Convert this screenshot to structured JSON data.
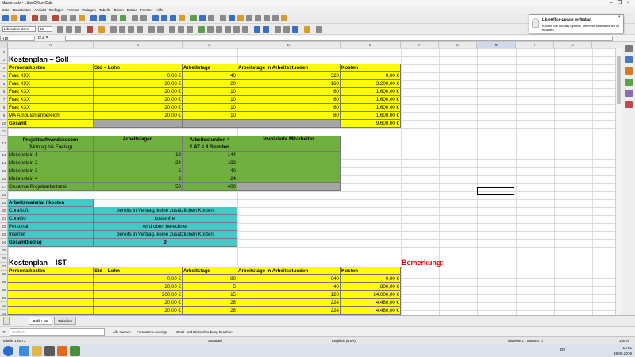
{
  "window": {
    "title": "Master.ods - LibreOffice Calc",
    "close_glyph": "×",
    "min_glyph": "–",
    "max_glyph": "❐"
  },
  "menu": [
    "Datei",
    "Bearbeiten",
    "Ansicht",
    "Einfügen",
    "Format",
    "Vorlagen",
    "Tabelle",
    "Daten",
    "Extras",
    "Fenster",
    "Hilfe"
  ],
  "formatting": {
    "font": "Liberation Sans",
    "size": "10"
  },
  "formula_bar": {
    "cell_ref": "H19",
    "fx": "fx Σ =",
    "value": ""
  },
  "notification": {
    "title": "LibreOffice-Update verfügbar",
    "body": "Klicken Sie auf das Symbol, um mehr Informationen zu erhalten.",
    "close": "×"
  },
  "columns": [
    "A",
    "B",
    "C",
    "D",
    "E",
    "F",
    "G",
    "H",
    "I",
    "J"
  ],
  "rows": [
    "1",
    "2",
    "3",
    "4",
    "5",
    "6",
    "7",
    "8",
    "9",
    "10",
    "11",
    "12",
    "13",
    "14",
    "15",
    "16",
    "17",
    "18",
    "19",
    "20",
    "21",
    "22",
    "23",
    "24",
    "25",
    "26",
    "27",
    "28",
    "29",
    "30",
    "31",
    "32",
    "33"
  ],
  "soll": {
    "title": "Kostenplan – Soll",
    "headers": [
      "Personalkosten",
      "Std – Lohn",
      "Arbeitstage",
      "Arbeitstage in Arbeitsstunden",
      "Kosten"
    ],
    "rows": [
      [
        "Frau XXX",
        "0,00 €",
        "40",
        "320",
        "0,00 €"
      ],
      [
        "Frau XXX",
        "20,00 €",
        "20",
        "160",
        "3.200,00 €"
      ],
      [
        "Frau XXX",
        "20,00 €",
        "10",
        "80",
        "1.600,00 €"
      ],
      [
        "Frau XXX",
        "20,00 €",
        "10",
        "80",
        "1.600,00 €"
      ],
      [
        "Frau XXX",
        "20,00 €",
        "10",
        "80",
        "1.600,00 €"
      ],
      [
        "MA Ambulantenbereich",
        "20,00 €",
        "10",
        "80",
        "1.600,00 €"
      ]
    ],
    "total_label": "Gesamt",
    "total_value": "9.600,00 €"
  },
  "projekt": {
    "header_a": "Projektaufwandskosten",
    "header_a2": "(Montag bis Freitag)",
    "header_b": "Arbeitstagen",
    "header_c": "Arbeitsstunden =",
    "header_c2": "1 AT = 8 Stunden",
    "header_d": "Involvierte Mitarbeiter",
    "rows": [
      [
        "Meilenstein 1",
        "18",
        "144"
      ],
      [
        "Meilenstein 2",
        "24",
        "192"
      ],
      [
        "Meilenstein 3",
        "5",
        "40"
      ],
      [
        "Meilenstein 4",
        "3",
        "24"
      ],
      [
        "Gesamte Projektarbeitszeit",
        "50",
        "400"
      ]
    ]
  },
  "material": {
    "header": "Arbeitsmaterial / kosten",
    "rows": [
      [
        "CuraSoft",
        "bereits in Vertrag, keine zusätzlichen Kosten"
      ],
      [
        "CuraGo",
        "kostenfrei"
      ],
      [
        "Personal",
        "wird oben berechnet"
      ],
      [
        "Internet",
        "bereits in Vertrag, keine zusätzlichen Kosten"
      ]
    ],
    "total_label": "Gesamtbetrag",
    "total_value": "0"
  },
  "ist": {
    "title": "Kostenplan – IST",
    "remark": "Bemerkung:",
    "headers": [
      "Personalkosten",
      "Std – Lohn",
      "Arbeitstage",
      "Arbeitstage in Arbeitsstunden",
      "Kosten"
    ],
    "rows": [
      [
        "",
        "0,00 €",
        "80",
        "640",
        "0,00 €"
      ],
      [
        "",
        "20,00 €",
        "5",
        "40",
        "800,00 €"
      ],
      [
        "",
        "200,00 €",
        "15",
        "120",
        "24.000,00 €"
      ],
      [
        "",
        "20,00 €",
        "28",
        "224",
        "4.480,00 €"
      ],
      [
        "",
        "20,00 €",
        "28",
        "224",
        "4.480,00 €"
      ]
    ]
  },
  "sheet_tabs": [
    "Soll + Ist",
    "Tabelle2"
  ],
  "find": {
    "placeholder": "Suchen",
    "all_label": "Alle suchen",
    "formatted_label": "Formatierte Anzeige",
    "case_label": "Groß- und Kleinschreibung beachten"
  },
  "status": {
    "sheet": "Tabelle 1 von 2",
    "style": "Standard",
    "lang": "Englisch (USA)",
    "calc": "Mittelwert: ; Summe: 0",
    "zoom": "150 %"
  },
  "taskbar": {
    "time": "10:01",
    "date": "18.05.2019",
    "lang": "DE"
  }
}
